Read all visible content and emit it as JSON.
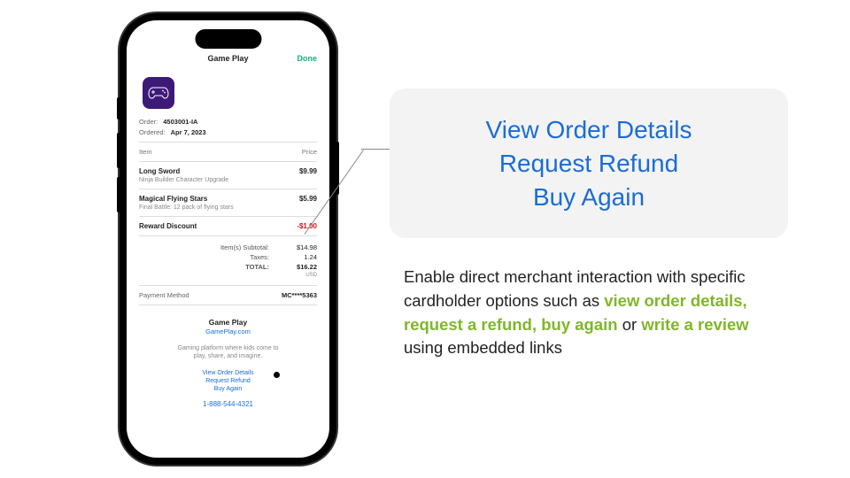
{
  "phone": {
    "nav": {
      "title": "Game Play",
      "done": "Done"
    },
    "order": {
      "label": "Order:",
      "number": "4503001-IA",
      "date_label": "Ordered:",
      "date": "Apr 7, 2023"
    },
    "item_header": {
      "item": "Item",
      "price": "Price"
    },
    "items": [
      {
        "name": "Long Sword",
        "desc": "Ninja Builder Character Upgrade",
        "price": "$9.99"
      },
      {
        "name": "Magical Flying Stars",
        "desc": "Final Battle: 12 pack of flying stars",
        "price": "$5.99"
      }
    ],
    "discount": {
      "label": "Reward Discount",
      "value": "-$1.00"
    },
    "totals": {
      "subtotal_label": "Item(s) Subtotal:",
      "subtotal": "$14.98",
      "taxes_label": "Taxes:",
      "taxes": "1.24",
      "total_label": "TOTAL:",
      "total": "$16.22",
      "currency": "USD"
    },
    "payment": {
      "label": "Payment Method",
      "value": "MC****5363"
    },
    "merchant": {
      "name": "Game Play",
      "url": "GamePlay.com",
      "tagline_l1": "Gaming platform where kids come to",
      "tagline_l2": "play, share, and imagine.",
      "link1": "View Order Details",
      "link2": "Request Refund",
      "link3": "Buy Again",
      "phone": "1-888-544-4321"
    }
  },
  "callout": {
    "l1": "View Order Details",
    "l2": "Request Refund",
    "l3": "Buy Again"
  },
  "desc": {
    "p1": "Enable direct merchant interaction with specific cardholder options such as ",
    "h1": "view order details, request a refund, buy again",
    "p2": " or ",
    "h2": "write a review",
    "p3": " using embedded links"
  }
}
